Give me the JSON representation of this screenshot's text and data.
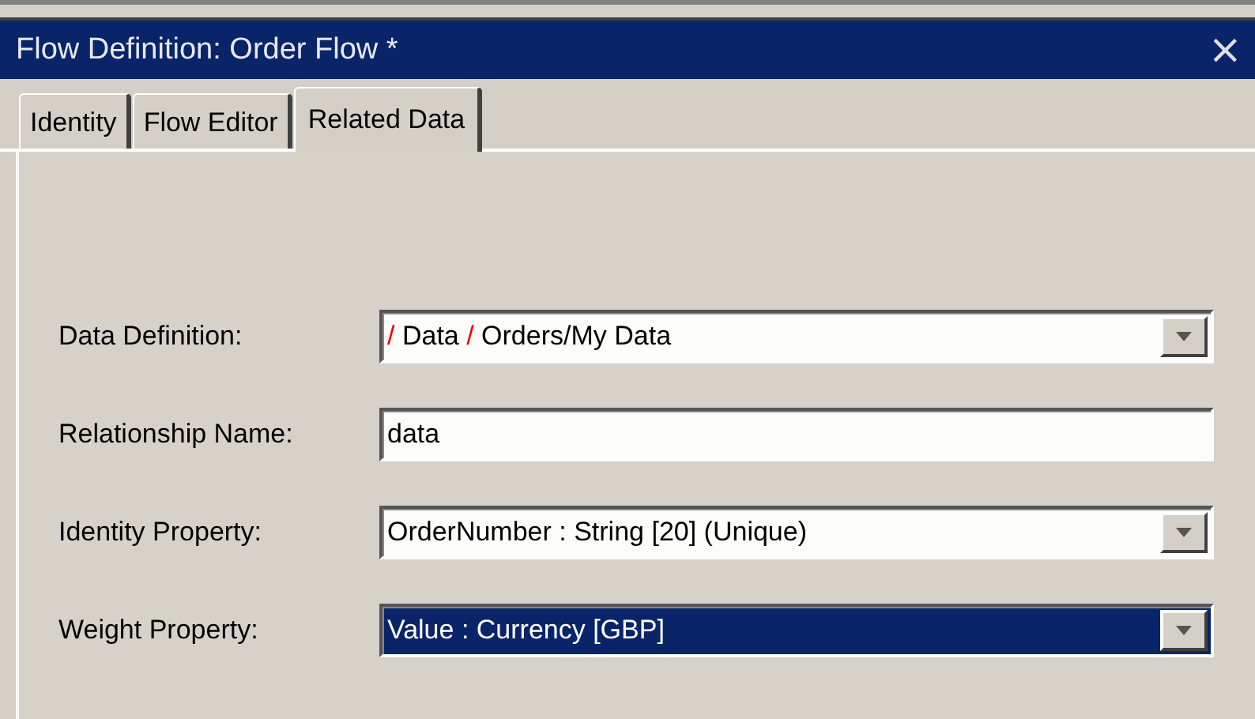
{
  "window": {
    "title": "Flow Definition: Order Flow *",
    "close": "×"
  },
  "tabs": [
    {
      "label": "Identity",
      "selected": false
    },
    {
      "label": "Flow Editor",
      "selected": false
    },
    {
      "label": "Related Data",
      "selected": true
    }
  ],
  "fields": [
    {
      "label": "Data Definition:",
      "kind": "dropdown",
      "selected": false,
      "value": [
        {
          "text": "/",
          "kind": "separator"
        },
        {
          "text": " Data ",
          "kind": "text"
        },
        {
          "text": "/",
          "kind": "separator"
        },
        {
          "text": " Orders/My Data",
          "kind": "text"
        }
      ]
    },
    {
      "label": "Relationship Name:",
      "kind": "text",
      "selected": false,
      "value": [
        {
          "text": "data",
          "kind": "text"
        }
      ]
    },
    {
      "label": "Identity Property:",
      "kind": "dropdown",
      "selected": false,
      "value": [
        {
          "text": "OrderNumber : String [20] (Unique)",
          "kind": "text"
        }
      ]
    },
    {
      "label": "Weight Property:",
      "kind": "dropdown",
      "selected": true,
      "value": [
        {
          "text": "Value : Currency [GBP]",
          "kind": "text"
        }
      ]
    }
  ]
}
